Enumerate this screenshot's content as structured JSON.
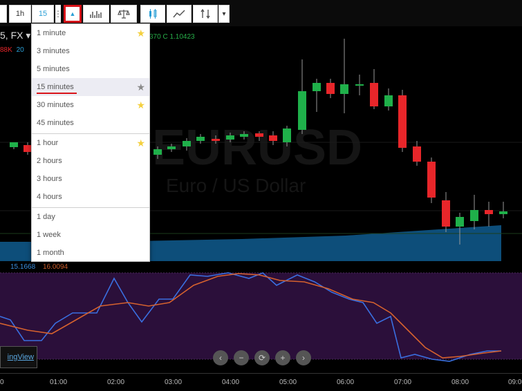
{
  "toolbar": {
    "interval_1h": "1h",
    "interval_15": "15",
    "more_dots": "⋮",
    "dropdown_arrow": "▲",
    "menu_arrow": "▾",
    "icons": [
      "bar-chart-icon",
      "compare-scale-icon",
      "candles-icon",
      "line-chart-icon",
      "indicators-icon"
    ]
  },
  "chart": {
    "symbol_label": "5, FX ▾",
    "legend_left_1": "88K",
    "legend_left_2": "20",
    "ohlc_text": "370  C  1.10423",
    "colors": {
      "up": "#1fb04a",
      "down": "#e8262a",
      "volume": "#0f5c8f",
      "osc_bg": "#2b0f3a",
      "osc_line1": "#3a6fe0",
      "osc_line2": "#d6622e"
    }
  },
  "dropdown": {
    "items": [
      {
        "label": "1 minute",
        "star": "fav"
      },
      {
        "label": "3 minutes",
        "star": ""
      },
      {
        "label": "5 minutes",
        "star": ""
      },
      {
        "label": "15 minutes",
        "star": "gray"
      },
      {
        "label": "30 minutes",
        "star": "fav"
      },
      {
        "label": "45 minutes",
        "star": ""
      },
      {
        "label": "1 hour",
        "star": "fav"
      },
      {
        "label": "2 hours",
        "star": ""
      },
      {
        "label": "3 hours",
        "star": ""
      },
      {
        "label": "4 hours",
        "star": ""
      },
      {
        "label": "1 day",
        "star": ""
      },
      {
        "label": "1 week",
        "star": ""
      },
      {
        "label": "1 month",
        "star": ""
      }
    ],
    "star_glyph": "★"
  },
  "oscillator": {
    "value1": "15.1668",
    "value2": "16.0094"
  },
  "logo_text": "ingView",
  "nav": [
    "‹",
    "−",
    "⟳",
    "+",
    "›"
  ],
  "time_axis": [
    "0",
    "01:00",
    "02:00",
    "03:00",
    "04:00",
    "05:00",
    "06:00",
    "07:00",
    "08:00",
    "09:0"
  ]
}
